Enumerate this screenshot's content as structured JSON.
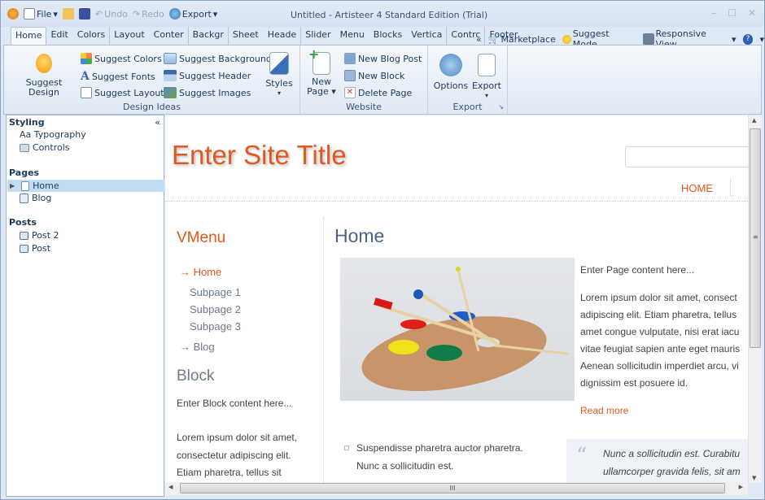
{
  "window": {
    "title": "Untitled - Artisteer 4 Standard Edition (Trial)",
    "controls": [
      "minimize",
      "maximize",
      "close"
    ]
  },
  "quick_access": {
    "file": "File",
    "undo": "Undo",
    "redo": "Redo",
    "export": "Export"
  },
  "tabs": [
    "Home",
    "Edit",
    "Colors",
    "Layout",
    "Conter",
    "Backgr",
    "Sheet",
    "Heade",
    "Slider",
    "Menu",
    "Blocks",
    "Vertica",
    "Contrc",
    "Footer"
  ],
  "tabs_right": {
    "collapse": "«",
    "marketplace": "Marketplace",
    "suggest_mode": "Suggest Mode",
    "responsive_view": "Responsive View"
  },
  "ribbon": {
    "design_ideas": {
      "label": "Design Ideas",
      "suggest_design": "Suggest Design",
      "suggest_colors": "Suggest Colors",
      "suggest_fonts": "Suggest Fonts",
      "suggest_layout": "Suggest Layout",
      "suggest_background": "Suggest Background",
      "suggest_header": "Suggest Header",
      "suggest_images": "Suggest Images",
      "styles": "Styles"
    },
    "website": {
      "label": "Website",
      "new_page_1": "New",
      "new_page_2": "Page",
      "new_blog_post": "New Blog Post",
      "new_block": "New Block",
      "delete_page": "Delete Page"
    },
    "export": {
      "label": "Export",
      "options": "Options",
      "export": "Export"
    }
  },
  "sidebar": {
    "collapse": "«",
    "styling": {
      "title": "Styling",
      "items": [
        "Aa Typography",
        "Controls"
      ]
    },
    "pages": {
      "title": "Pages",
      "items": [
        "Home",
        "Blog"
      ],
      "selected": "Home"
    },
    "posts": {
      "title": "Posts",
      "items": [
        "Post 2",
        "Post"
      ]
    }
  },
  "site": {
    "title": "Enter Site Title",
    "nav": [
      "HOME"
    ],
    "vmenu_title": "VMenu",
    "vmenu": [
      "→ Home",
      "Subpage 1",
      "Subpage 2",
      "Subpage 3",
      "→ Blog"
    ],
    "block_title": "Block",
    "block_intro": "Enter Block content here...",
    "block_text": [
      "Lorem ipsum dolor sit amet,",
      "consectetur adipiscing elit.",
      "Etiam pharetra, tellus sit"
    ],
    "page_title": "Home",
    "page_intro": "Enter Page content here...",
    "page_text": [
      "Lorem ipsum dolor sit amet, consect",
      "adipiscing elit. Etiam pharetra, tellus",
      "amet congue vulputate, nisi erat iacu",
      "vitae feugiat sapien ante eget mauris",
      "Aenean sollicitudin imperdiet arcu, vi",
      "dignissim est posuere id."
    ],
    "read_more": "Read more",
    "list_item": [
      "Suspendisse pharetra auctor pharetra.",
      "Nunc a sollicitudin est."
    ],
    "quote": [
      "Nunc a sollicitudin est. Curabitu",
      "ullamcorper gravida felis, sit am"
    ]
  },
  "colors": {
    "accent": "#e0581e",
    "heading": "#4a6584",
    "ribbon": "#dfe8f4"
  }
}
